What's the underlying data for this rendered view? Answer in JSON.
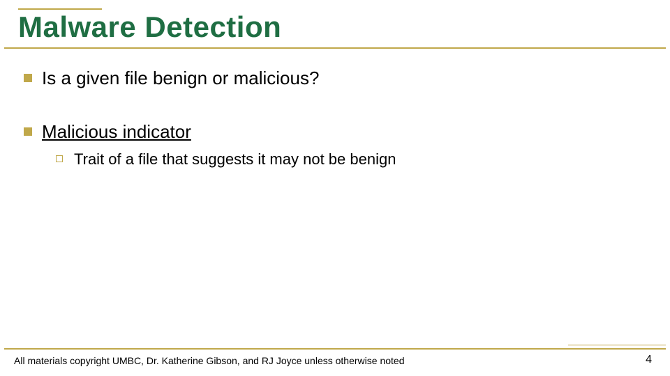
{
  "slide": {
    "title": "Malware Detection",
    "bullets": [
      {
        "text": "Is a given file benign or malicious?",
        "underline": false
      },
      {
        "text": "Malicious indicator",
        "underline": true,
        "sub": [
          {
            "text": "Trait of a file that suggests it may not be benign"
          }
        ]
      }
    ],
    "footer": {
      "copyright": "All materials copyright UMBC, Dr. Katherine Gibson, and RJ Joyce unless otherwise noted",
      "page_number": "4"
    },
    "colors": {
      "accent": "#c0a84a",
      "title": "#1f6e43"
    }
  }
}
